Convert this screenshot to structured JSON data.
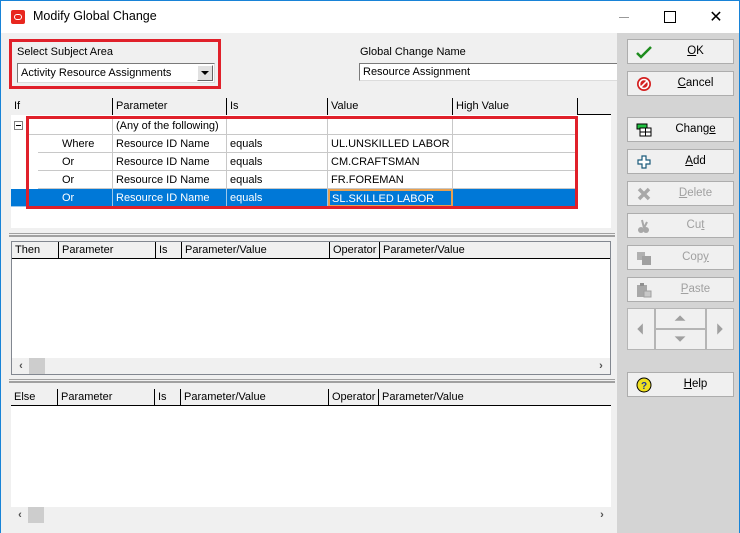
{
  "window": {
    "title": "Modify Global Change",
    "icon": "oracle-logo-icon",
    "controls": {
      "minimize": "minimize-icon",
      "maximize": "maximize-icon",
      "close": "✕"
    }
  },
  "subject_area": {
    "label": "Select Subject Area",
    "selected": "Activity Resource Assignments"
  },
  "global_change_name": {
    "label": "Global Change Name",
    "value": "Resource Assignment"
  },
  "if_grid": {
    "headers": [
      "If",
      "Parameter",
      "Is",
      "Value",
      "High Value"
    ],
    "group_row": {
      "parameter": "(Any of the following)",
      "expanded": true
    },
    "rows": [
      {
        "if": "Where",
        "parameter": "Resource ID Name",
        "is": "equals",
        "value": "UL.UNSKILLED LABOR",
        "high_value": ""
      },
      {
        "if": "Or",
        "parameter": "Resource ID Name",
        "is": "equals",
        "value": "CM.CRAFTSMAN",
        "high_value": ""
      },
      {
        "if": "Or",
        "parameter": "Resource ID Name",
        "is": "equals",
        "value": "FR.FOREMAN",
        "high_value": ""
      },
      {
        "if": "Or",
        "parameter": "Resource ID Name",
        "is": "equals",
        "value": "SL.SKILLED LABOR",
        "high_value": "",
        "selected": true
      }
    ]
  },
  "then_grid": {
    "headers": [
      "Then",
      "Parameter",
      "Is",
      "Parameter/Value",
      "Operator",
      "Parameter/Value"
    ]
  },
  "else_grid": {
    "headers": [
      "Else",
      "Parameter",
      "Is",
      "Parameter/Value",
      "Operator",
      "Parameter/Value"
    ]
  },
  "scroll": {
    "left": "‹",
    "right": "›"
  },
  "buttons": {
    "ok": {
      "pre": "",
      "u": "O",
      "post": "K",
      "icon": "checkmark-icon",
      "enabled": true
    },
    "cancel": {
      "pre": "",
      "u": "C",
      "post": "ancel",
      "icon": "no-entry-icon",
      "enabled": true
    },
    "change": {
      "pre": "Chang",
      "u": "e",
      "post": "",
      "icon": "change-table-icon",
      "enabled": true
    },
    "add": {
      "pre": "",
      "u": "A",
      "post": "dd",
      "icon": "plus-icon",
      "enabled": true
    },
    "delete": {
      "pre": "",
      "u": "D",
      "post": "elete",
      "icon": "x-icon",
      "enabled": false
    },
    "cut": {
      "pre": "Cu",
      "u": "t",
      "post": "",
      "icon": "scissors-icon",
      "enabled": false
    },
    "copy": {
      "pre": "Cop",
      "u": "y",
      "post": "",
      "icon": "copy-icon",
      "enabled": false
    },
    "paste": {
      "pre": "",
      "u": "P",
      "post": "aste",
      "icon": "paste-icon",
      "enabled": false
    },
    "help": {
      "pre": "",
      "u": "H",
      "post": "elp",
      "icon": "help-icon",
      "enabled": true
    }
  },
  "colors": {
    "selection": "#0078d7",
    "highlight_box": "#e0202a",
    "focus_cell": "#e8a050"
  }
}
